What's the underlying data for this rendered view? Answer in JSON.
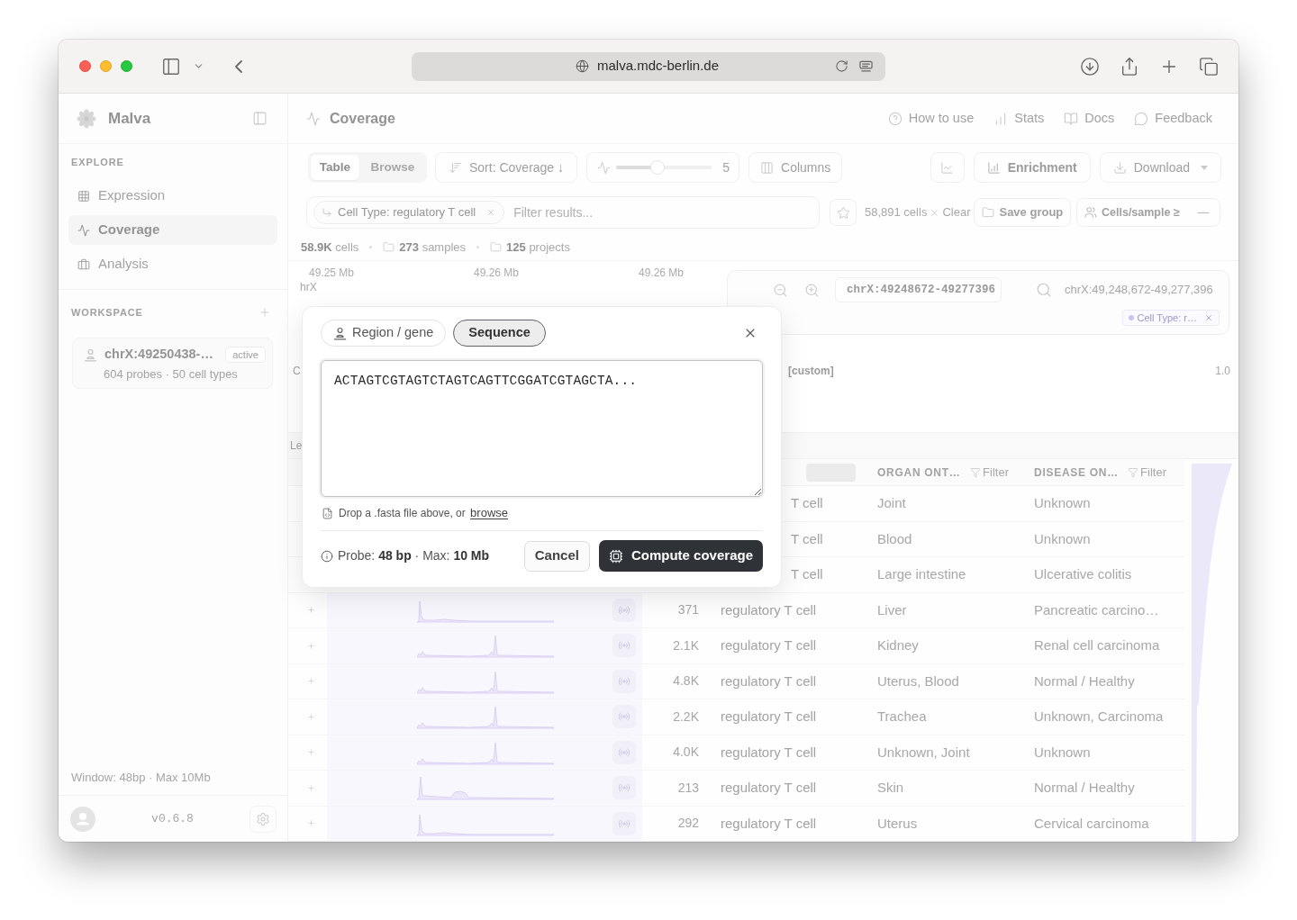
{
  "browser": {
    "url": "malva.mdc-berlin.de"
  },
  "sidebar": {
    "brand": "Malva",
    "explore_label": "EXPLORE",
    "nav_items": [
      {
        "label": "Expression",
        "kind": "expression",
        "selected": false
      },
      {
        "label": "Coverage",
        "kind": "coverage",
        "selected": true
      },
      {
        "label": "Analysis",
        "kind": "analysis",
        "selected": false
      }
    ],
    "workspace_label": "WORKSPACE",
    "workspaces": [
      {
        "title": "chrX:49250438-…",
        "badge": "active",
        "subtitle": "604 probes · 50 cell types"
      }
    ],
    "window_info": "Window: 48bp · Max 10Mb",
    "version": "v0.6.8"
  },
  "header": {
    "title": "Coverage",
    "links": [
      {
        "label": "How to use",
        "kind": "help"
      },
      {
        "label": "Stats",
        "kind": "stats"
      },
      {
        "label": "Docs",
        "kind": "docs"
      },
      {
        "label": "Feedback",
        "kind": "feedback"
      }
    ]
  },
  "toolbar": {
    "view_tabs": [
      {
        "label": "Table",
        "selected": true
      },
      {
        "label": "Browse",
        "selected": false
      }
    ],
    "sort": "Sort: Coverage ↓",
    "smoothing": {
      "level": 0.43,
      "reading": "5"
    },
    "columns": "Columns",
    "enrichment": "Enrichment",
    "download": "Download"
  },
  "filters": {
    "chips": [
      {
        "label": "Cell Type: regulatory T cell"
      }
    ],
    "placeholder": "Filter results...",
    "cell_count": "58,891 cells",
    "clear": "Clear",
    "save_group": "Save group",
    "min_cells": {
      "label": "Cells/sample ≥",
      "placeholder": "—"
    }
  },
  "summary": [
    {
      "text": "**58.9K** cells",
      "kind": "cells"
    },
    {
      "text": "**273** samples",
      "kind": "samples"
    },
    {
      "text": "**125** projects",
      "kind": "projects"
    }
  ],
  "genome_view": {
    "axis_labels": [
      "49.25 Mb",
      "49.26 Mb",
      "49.26 Mb"
    ],
    "chromosome": "hrX",
    "locus_input": "chrX:49248672-49277396",
    "locus_display": "chrX:49,248,672-49,277,396",
    "filter_chip": "Cell Type: r…",
    "gutter_track_label": "C",
    "track_label": "[custom]",
    "scale_max": "1.0",
    "gutter_section_label": "Le"
  },
  "table": {
    "columns": [
      {
        "label": "ORGAN ONT…",
        "filter": "Filter"
      },
      {
        "label": "DISEASE ON…",
        "filter": "Filter"
      }
    ],
    "rows": [
      {
        "kind": "partial",
        "cell_type": "T cell",
        "organ": "Joint",
        "disease": "Unknown"
      },
      {
        "kind": "partial",
        "cell_type": "T cell",
        "organ": "Blood",
        "disease": "Unknown"
      },
      {
        "kind": "partial",
        "cell_type": "T cell",
        "organ": "Large intestine",
        "disease": "Ulcerative colitis"
      },
      {
        "kind": "full",
        "count": "371",
        "cell_type": "regulatory T cell",
        "organ": "Liver",
        "disease": "Pancreatic carcino…"
      },
      {
        "kind": "full",
        "count": "2.1K",
        "cell_type": "regulatory T cell",
        "organ": "Kidney",
        "disease": "Renal cell carcinoma"
      },
      {
        "kind": "full",
        "count": "4.8K",
        "cell_type": "regulatory T cell",
        "organ": "Uterus, Blood",
        "disease": "Normal / Healthy"
      },
      {
        "kind": "full",
        "count": "2.2K",
        "cell_type": "regulatory T cell",
        "organ": "Trachea",
        "disease": "Unknown, Carcinoma"
      },
      {
        "kind": "full",
        "count": "4.0K",
        "cell_type": "regulatory T cell",
        "organ": "Unknown, Joint",
        "disease": "Unknown"
      },
      {
        "kind": "full",
        "count": "213",
        "cell_type": "regulatory T cell",
        "organ": "Skin",
        "disease": "Normal / Healthy"
      },
      {
        "kind": "full",
        "count": "292",
        "cell_type": "regulatory T cell",
        "organ": "Uterus",
        "disease": "Cervical carcinoma"
      }
    ]
  },
  "dialog": {
    "tabs": [
      {
        "label": "Region / gene",
        "kind": "region",
        "selected": false
      },
      {
        "label": "Sequence",
        "kind": "sequence",
        "selected": true
      }
    ],
    "sequence": "ACTAGTCGTAGTCTAGTCAGTTCGGATCGTAGCTA...",
    "drop_hint": "Drop a .fasta file above, or",
    "browse": "browse",
    "limits": "Probe: **48 bp** · Max: **10 Mb**",
    "cancel": "Cancel",
    "submit": "Compute coverage"
  }
}
